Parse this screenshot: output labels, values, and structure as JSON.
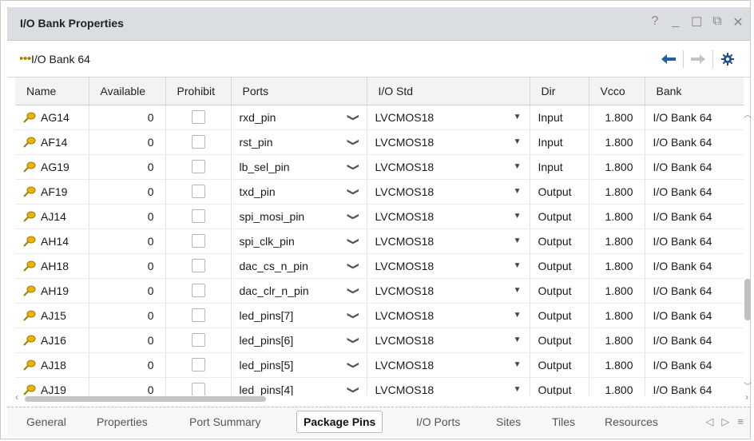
{
  "window": {
    "title": "I/O Bank Properties",
    "controls": [
      "?",
      "_",
      "☐",
      "⧉",
      "✕"
    ]
  },
  "toolbar": {
    "bank_label": "I/O Bank 64",
    "back_icon": "back-arrow-icon",
    "forward_icon": "forward-arrow-icon",
    "settings_icon": "gear-icon"
  },
  "table": {
    "columns": [
      "Name",
      "Available",
      "Prohibit",
      "Ports",
      "I/O Std",
      "Dir",
      "Vcco",
      "Bank"
    ],
    "rows": [
      {
        "name": "AG14",
        "available": "0",
        "port": "rxd_pin",
        "iostd": "LVCMOS18",
        "dir": "Input",
        "vcco": "1.800",
        "bank": "I/O Bank 64"
      },
      {
        "name": "AF14",
        "available": "0",
        "port": "rst_pin",
        "iostd": "LVCMOS18",
        "dir": "Input",
        "vcco": "1.800",
        "bank": "I/O Bank 64"
      },
      {
        "name": "AG19",
        "available": "0",
        "port": "lb_sel_pin",
        "iostd": "LVCMOS18",
        "dir": "Input",
        "vcco": "1.800",
        "bank": "I/O Bank 64"
      },
      {
        "name": "AF19",
        "available": "0",
        "port": "txd_pin",
        "iostd": "LVCMOS18",
        "dir": "Output",
        "vcco": "1.800",
        "bank": "I/O Bank 64"
      },
      {
        "name": "AJ14",
        "available": "0",
        "port": "spi_mosi_pin",
        "iostd": "LVCMOS18",
        "dir": "Output",
        "vcco": "1.800",
        "bank": "I/O Bank 64"
      },
      {
        "name": "AH14",
        "available": "0",
        "port": "spi_clk_pin",
        "iostd": "LVCMOS18",
        "dir": "Output",
        "vcco": "1.800",
        "bank": "I/O Bank 64"
      },
      {
        "name": "AH18",
        "available": "0",
        "port": "dac_cs_n_pin",
        "iostd": "LVCMOS18",
        "dir": "Output",
        "vcco": "1.800",
        "bank": "I/O Bank 64"
      },
      {
        "name": "AH19",
        "available": "0",
        "port": "dac_clr_n_pin",
        "iostd": "LVCMOS18",
        "dir": "Output",
        "vcco": "1.800",
        "bank": "I/O Bank 64"
      },
      {
        "name": "AJ15",
        "available": "0",
        "port": "led_pins[7]",
        "iostd": "LVCMOS18",
        "dir": "Output",
        "vcco": "1.800",
        "bank": "I/O Bank 64"
      },
      {
        "name": "AJ16",
        "available": "0",
        "port": "led_pins[6]",
        "iostd": "LVCMOS18",
        "dir": "Output",
        "vcco": "1.800",
        "bank": "I/O Bank 64"
      },
      {
        "name": "AJ18",
        "available": "0",
        "port": "led_pins[5]",
        "iostd": "LVCMOS18",
        "dir": "Output",
        "vcco": "1.800",
        "bank": "I/O Bank 64"
      },
      {
        "name": "AJ19",
        "available": "0",
        "port": "led_pins[4]",
        "iostd": "LVCMOS18",
        "dir": "Output",
        "vcco": "1.800",
        "bank": "I/O Bank 64"
      }
    ]
  },
  "tabs": {
    "items": [
      "General",
      "Properties",
      "Port Summary",
      "Package Pins",
      "I/O Ports",
      "Sites",
      "Tiles",
      "Resources"
    ],
    "active": "Package Pins"
  },
  "colors": {
    "titlebar_bg": "#dadde1",
    "arrow_active": "#1f5fa8",
    "pin_icon": "#d9a400"
  }
}
